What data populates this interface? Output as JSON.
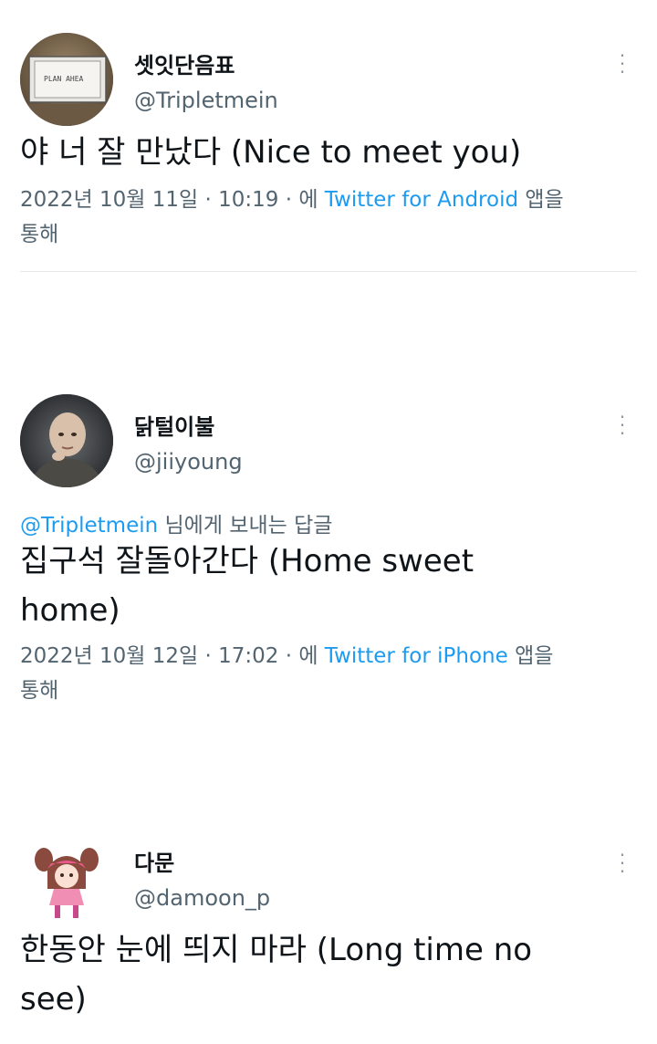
{
  "tweets": [
    {
      "display_name": "셋잇단음표",
      "handle": "@Tripletmein",
      "reply_prefix": "",
      "reply_to": "",
      "reply_suffix": "",
      "text": "야 너 잘 만났다 (Nice to meet you)",
      "date": "2022년 10월 11일 · 10:19 · 에",
      "app": "Twitter for Android",
      "app_suffix": "앱을",
      "app_suffix2": "통해",
      "avatar_icon": "plan-sign-photo-avatar",
      "avatar_text": "PLAN AHEA"
    },
    {
      "display_name": "닭털이불",
      "handle": "@jiiyoung",
      "reply_to": "@Tripletmein",
      "reply_suffix": " 님에게 보내는 답글",
      "text_line1": "집구석 잘돌아간다 (Home sweet",
      "text_line2": "home)",
      "date": "2022년 10월 12일 · 17:02 · 에",
      "app": "Twitter for iPhone",
      "app_suffix": "앱을",
      "app_suffix2": "통해",
      "avatar_icon": "bald-man-photo-avatar"
    },
    {
      "display_name": "다문",
      "handle": "@damoon_p",
      "text_line1": "한동안 눈에 띄지 마라 (Long time no",
      "text_line2": "see)",
      "avatar_icon": "anime-girl-avatar"
    }
  ],
  "colors": {
    "link_blue": "#1d9bf0",
    "secondary_gray": "#536471",
    "text": "#0f1419"
  }
}
